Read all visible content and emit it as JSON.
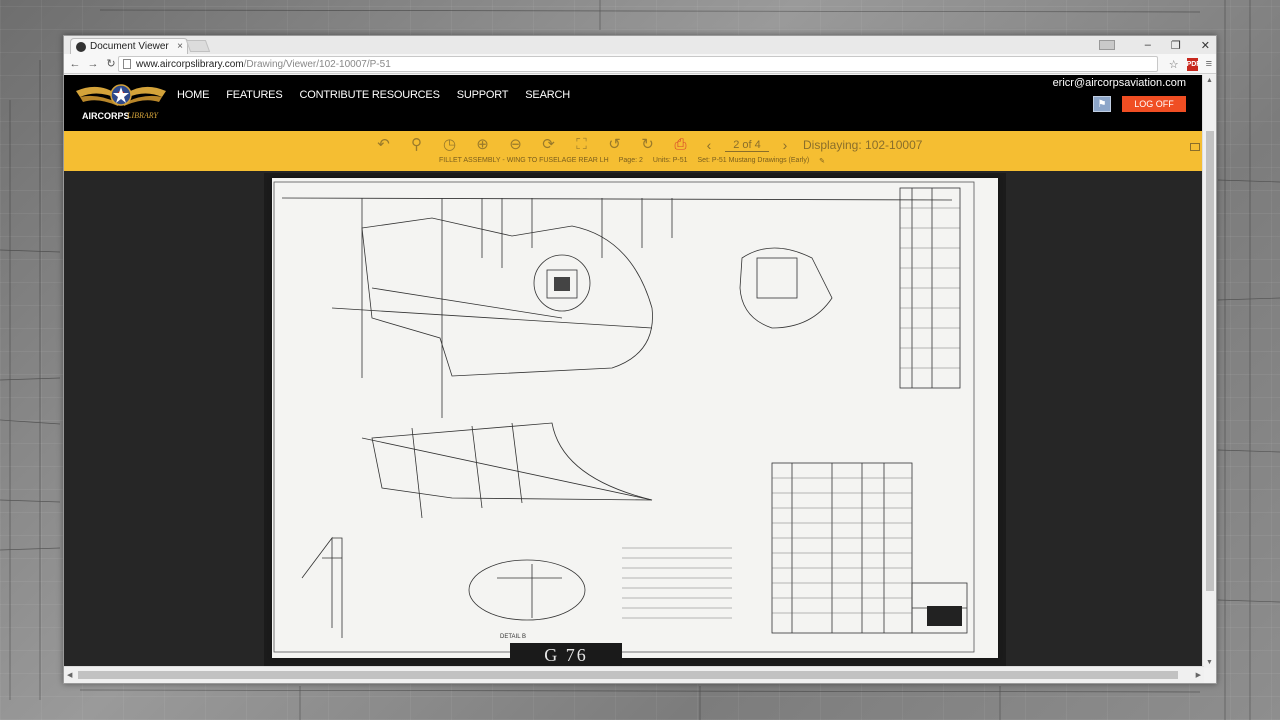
{
  "browser": {
    "tab_title": "Document Viewer",
    "tab_close": "×",
    "url_host": "www.aircorpslibrary.com",
    "url_path": "/Drawing/Viewer/102-10007/P-51",
    "pdf_badge": "PDF",
    "icons": {
      "back": "arrow-left",
      "forward": "arrow-right",
      "reload": "reload",
      "star": "star",
      "menu": "hamburger"
    },
    "window_controls": [
      "–",
      "❐",
      "✕"
    ]
  },
  "site": {
    "logo_text": "AIRCORPS LIBRARY",
    "nav": [
      "HOME",
      "FEATURES",
      "CONTRIBUTE RESOURCES",
      "SUPPORT",
      "SEARCH"
    ],
    "user_email": "ericr@aircorpsaviation.com",
    "logoff_label": "LOG OFF",
    "accent_color": "#f5be32",
    "logoff_color": "#f04e23"
  },
  "viewer": {
    "tools": [
      "back-arrow",
      "search",
      "zoom-reset",
      "zoom-in",
      "zoom-out",
      "rotate",
      "fit-page",
      "rotate-left",
      "rotate-right",
      "print"
    ],
    "page_indicator": "2 of 4",
    "display_label": "Displaying: 102-10007",
    "meta": {
      "title": "FILLET ASSEMBLY - WING TO FUSELAGE REAR LH",
      "page": "Page: 2",
      "units": "Units: P-51",
      "set": "Set: P-51 Mustang Drawings (Early)"
    },
    "frame_label": "G  76",
    "drawing_labels": {
      "detail": "DETAIL B"
    }
  }
}
